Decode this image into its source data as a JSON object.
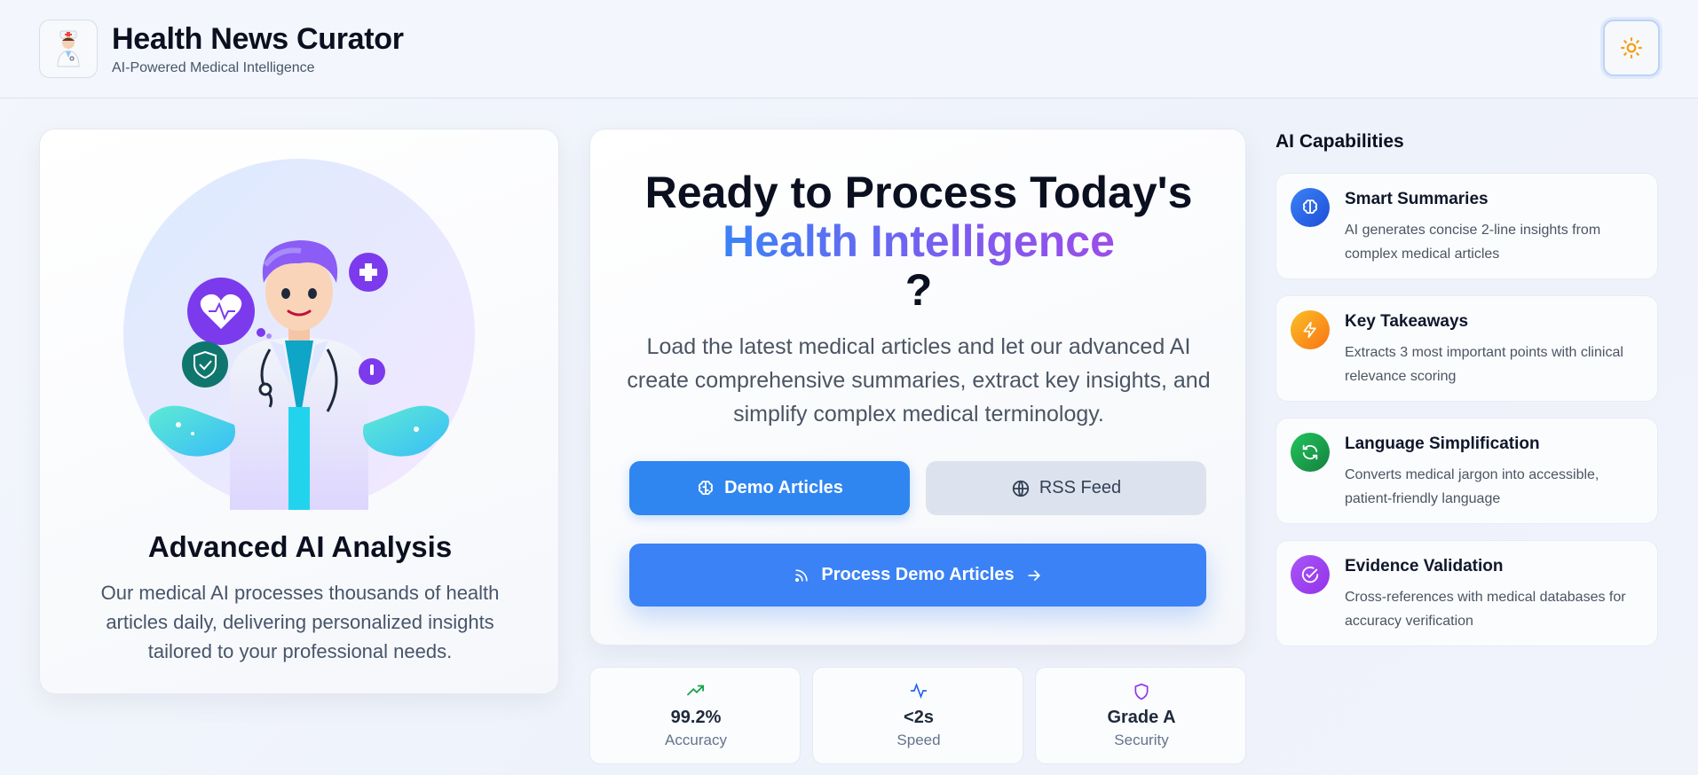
{
  "header": {
    "title": "Health News Curator",
    "subtitle": "AI-Powered Medical Intelligence",
    "logo_icon": "doctor-avatar-icon",
    "theme_toggle_icon": "sun-icon"
  },
  "left_card": {
    "title": "Advanced AI Analysis",
    "description": "Our medical AI processes thousands of health articles daily, delivering personalized insights tailored to your professional needs."
  },
  "hero": {
    "line1": "Ready to Process Today's",
    "line2": "Health Intelligence",
    "line3": "?",
    "description": "Load the latest medical articles and let our advanced AI create comprehensive summaries, extract key insights, and simplify complex medical terminology.",
    "demo_button": "Demo Articles",
    "rss_button": "RSS Feed",
    "process_button": "Process Demo Articles"
  },
  "stats": [
    {
      "value": "99.2%",
      "label": "Accuracy",
      "icon": "trending-up-icon",
      "color": "#16a34a"
    },
    {
      "value": "<2s",
      "label": "Speed",
      "icon": "activity-icon",
      "color": "#2563eb"
    },
    {
      "value": "Grade A",
      "label": "Security",
      "icon": "shield-icon",
      "color": "#9333ea"
    }
  ],
  "capabilities": {
    "heading": "AI Capabilities",
    "items": [
      {
        "title": "Smart Summaries",
        "description": "AI generates concise 2-line insights from complex medical articles",
        "icon": "brain-icon",
        "color": "#2f6fe0"
      },
      {
        "title": "Key Takeaways",
        "description": "Extracts 3 most important points with clinical relevance scoring",
        "icon": "zap-icon",
        "color": "#f59e0b"
      },
      {
        "title": "Language Simplification",
        "description": "Converts medical jargon into accessible, patient-friendly language",
        "icon": "refresh-icon",
        "color": "#16a34a"
      },
      {
        "title": "Evidence Validation",
        "description": "Cross-references with medical databases for accuracy verification",
        "icon": "check-circle-icon",
        "color": "#9b4de8"
      }
    ]
  },
  "colors": {
    "primary": "#2f86f0",
    "process": "#3b82f6",
    "gradient_start": "#3b82f6",
    "gradient_end": "#9b4de8"
  }
}
